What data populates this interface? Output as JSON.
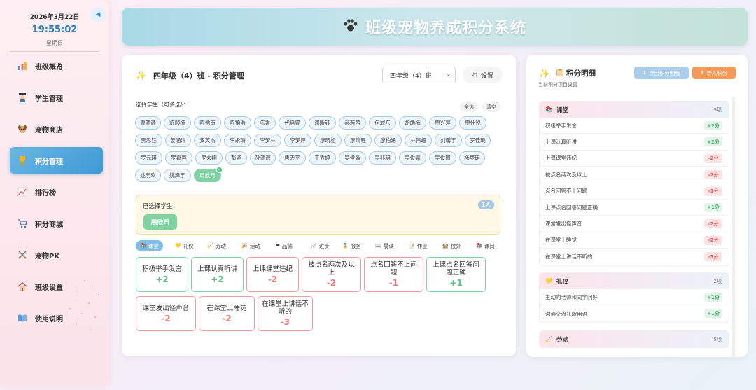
{
  "sidebar": {
    "date": "2026年3月22日",
    "time": "19:55:02",
    "weekday": "星期日",
    "collapse_icon": "◀",
    "items": [
      {
        "label": "班级概览",
        "icon": "chart-icon"
      },
      {
        "label": "学生管理",
        "icon": "student-icon"
      },
      {
        "label": "宠物商店",
        "icon": "dog-icon"
      },
      {
        "label": "积分管理",
        "icon": "trophy-icon",
        "active": true
      },
      {
        "label": "排行榜",
        "icon": "trend-icon"
      },
      {
        "label": "积分商城",
        "icon": "cart-icon"
      },
      {
        "label": "宠物PK",
        "icon": "swords-icon"
      },
      {
        "label": "班级设置",
        "icon": "house-icon"
      },
      {
        "label": "使用说明",
        "icon": "book-icon"
      }
    ]
  },
  "header": {
    "title": "班级宠物养成积分系统",
    "icon": "paw-icon"
  },
  "main": {
    "title": "四年级（4）班 - 积分管理",
    "class_select": "四年级（4）班",
    "settings_label": "设置",
    "select_label": "选择学生（可多选）：",
    "select_all": "全选",
    "clear": "清空",
    "students": [
      "曹源源",
      "陈顺楠",
      "陈浩南",
      "陈锦浩",
      "陈香",
      "代启睿",
      "邓昕钰",
      "郝若茜",
      "何城东",
      "胡皓楠",
      "贾兴萍",
      "贾仕锐",
      "贾思钰",
      "姜涵洋",
      "黎英杰",
      "李永琦",
      "李梦林",
      "李梦婷",
      "廖晓松",
      "廖晴程",
      "廖柏涵",
      "林伟超",
      "刘馨宇",
      "罗佳璐",
      "罗元琪",
      "罗嘉蓉",
      "罗会翔",
      "彭涵",
      "孙源源",
      "唐天平",
      "王秀婷",
      "吴俊淼",
      "吴兆玥",
      "吴俊霖",
      "吴俊熙",
      "杨梦琪",
      "姚明欢",
      "姚泽宇",
      "周欣月"
    ],
    "selected_student": "周欣月",
    "selected_label": "已选择学生：",
    "selected_count": "1人",
    "categories": [
      {
        "label": "课堂",
        "active": true
      },
      {
        "label": "礼仪"
      },
      {
        "label": "劳动"
      },
      {
        "label": "活动"
      },
      {
        "label": "品德"
      },
      {
        "label": "进步"
      },
      {
        "label": "服务"
      },
      {
        "label": "晨读"
      },
      {
        "label": "作业"
      },
      {
        "label": "校外"
      },
      {
        "label": "课间"
      }
    ],
    "rules": [
      {
        "name": "积极举手发言",
        "value": "+2"
      },
      {
        "name": "上课认真听讲",
        "value": "+2"
      },
      {
        "name": "上课课堂违纪",
        "value": "-2"
      },
      {
        "name": "被点名两次及以上",
        "value": "-2"
      },
      {
        "name": "点名回答不上问题",
        "value": "-1"
      },
      {
        "name": "上课点名回答问题正确",
        "value": "+1"
      },
      {
        "name": "课堂发出怪声音",
        "value": "-2"
      },
      {
        "name": "在课堂上睡觉",
        "value": "-2"
      },
      {
        "name": "在课堂上讲话不听的",
        "value": "-3"
      }
    ]
  },
  "detail": {
    "title": "积分明细",
    "subtitle": "当前积分项目设置",
    "export_label": "导出积分明细",
    "import_label": "导入积分",
    "groups": [
      {
        "name": "课堂",
        "count": "9项",
        "rows": [
          {
            "name": "积极举手发言",
            "value": "+2分",
            "pos": true
          },
          {
            "name": "上课认真听讲",
            "value": "+2分",
            "pos": true
          },
          {
            "name": "上课课堂违纪",
            "value": "-2分",
            "pos": false
          },
          {
            "name": "被点名两次及以上",
            "value": "-2分",
            "pos": false
          },
          {
            "name": "点名回答不上问题",
            "value": "-1分",
            "pos": false
          },
          {
            "name": "上课点名回答问题正确",
            "value": "+1分",
            "pos": true
          },
          {
            "name": "课堂发出怪声音",
            "value": "-2分",
            "pos": false
          },
          {
            "name": "在课堂上睡觉",
            "value": "-2分",
            "pos": false
          },
          {
            "name": "在课堂上讲话不听的",
            "value": "-3分",
            "pos": false
          }
        ]
      },
      {
        "name": "礼仪",
        "count": "2项",
        "rows": [
          {
            "name": "主动向老师和同学问好",
            "value": "+1分",
            "pos": true
          },
          {
            "name": "沟通交流礼貌用语",
            "value": "+1分",
            "pos": true
          }
        ]
      },
      {
        "name": "劳动",
        "count": "5项",
        "rows": []
      }
    ]
  }
}
